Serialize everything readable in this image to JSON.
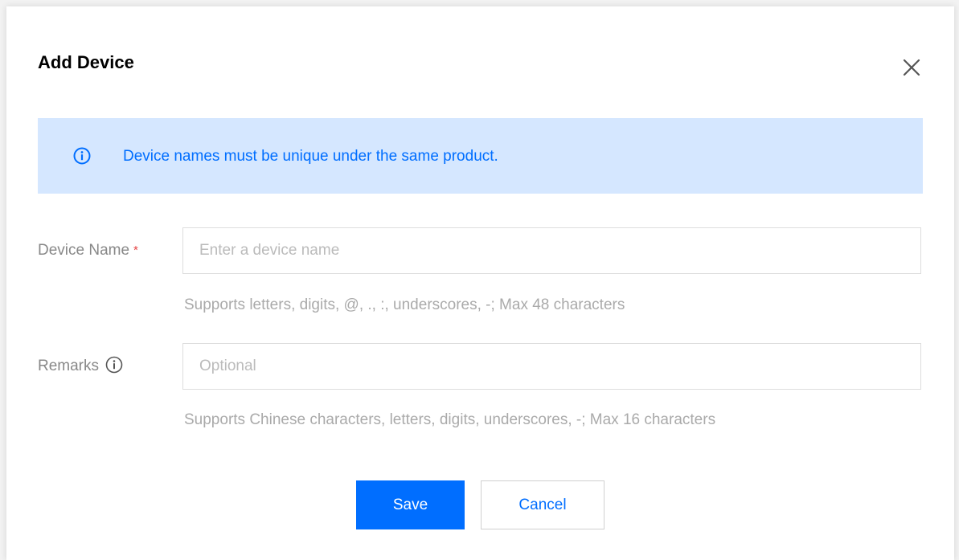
{
  "dialog": {
    "title": "Add Device"
  },
  "notice": {
    "icon": "info-circle-icon",
    "text": "Device names must be unique under the same product.",
    "background": "#d5e7ff",
    "text_color": "#006eff"
  },
  "form": {
    "device_name": {
      "label": "Device Name",
      "required_mark": "*",
      "placeholder": "Enter a device name",
      "value": "",
      "help": "Supports letters, digits, @, ., :, underscores, -; Max 48 characters"
    },
    "remarks": {
      "label": "Remarks",
      "label_icon": "info-circle-icon",
      "placeholder": "Optional",
      "value": "",
      "help": "Supports Chinese characters, letters, digits, underscores, -; Max 16 characters"
    }
  },
  "actions": {
    "save_label": "Save",
    "cancel_label": "Cancel",
    "primary_color": "#006eff"
  }
}
